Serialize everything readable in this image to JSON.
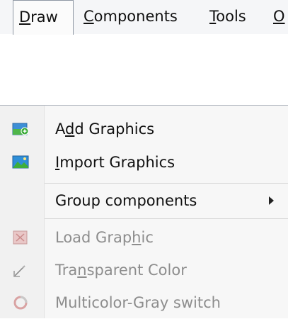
{
  "menubar": {
    "items": [
      {
        "label": "Draw",
        "underline": "D",
        "rest": "raw",
        "active": true
      },
      {
        "label": "Components",
        "underline": "C",
        "rest": "omponents"
      },
      {
        "label": "Tools",
        "underline": "T",
        "rest": "ools"
      },
      {
        "label": "O",
        "underline": "O",
        "rest": ""
      }
    ]
  },
  "menu": {
    "items": [
      {
        "before": "A",
        "underline": "d",
        "after": "d Graphics",
        "label": "Add Graphics",
        "icon": "add-graphics-icon",
        "disabled": false
      },
      {
        "before": "",
        "underline": "I",
        "after": "mport Graphics",
        "label": "Import Graphics",
        "icon": "import-graphics-icon",
        "disabled": false
      },
      {
        "before": "Group components",
        "underline": "",
        "after": "",
        "label": "Group components",
        "icon": "",
        "disabled": false,
        "submenu": true
      },
      {
        "before": "Load Grap",
        "underline": "h",
        "after": "ic",
        "label": "Load Graphic",
        "icon": "load-graphic-icon",
        "disabled": true
      },
      {
        "before": "Tra",
        "underline": "n",
        "after": "sparent Color",
        "label": "Transparent Color",
        "icon": "transparent-color-icon",
        "disabled": true
      },
      {
        "before": "Multicolor-Gray switch",
        "underline": "",
        "after": "",
        "label": "Multicolor-Gray switch",
        "icon": "multicolor-gray-switch-icon",
        "disabled": true
      }
    ],
    "submenu_arrow_icon": "submenu-arrow-icon"
  },
  "colors": {
    "menubar_bg": "#f5f6f8",
    "menu_bg": "#f7f7f7",
    "icon_column_bg": "#f1f1f1",
    "disabled_text": "#8d8d8d",
    "active_border": "#8f98a4"
  }
}
